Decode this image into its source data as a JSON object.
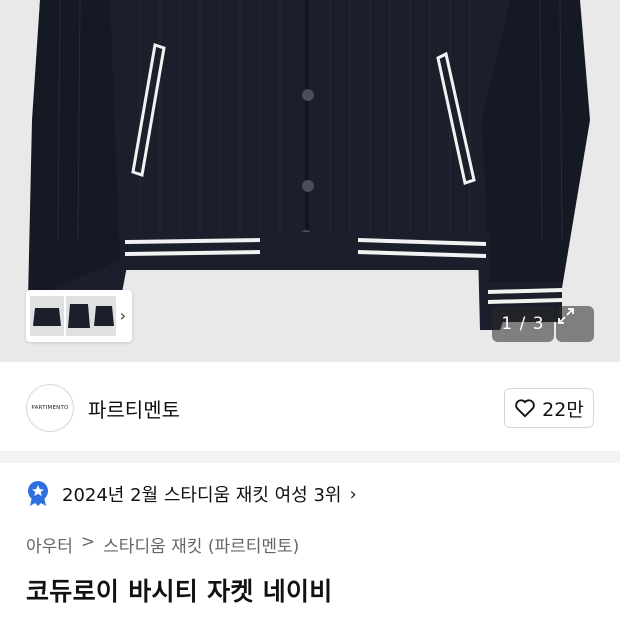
{
  "gallery": {
    "counter": "1 / 3",
    "thumbnail_count": 3
  },
  "seller": {
    "logo_text": "PARTIMENTO",
    "name": "파르티멘토",
    "like_count": "22만"
  },
  "ranking": {
    "text": "2024년 2월 스타디움 재킷 여성 3위"
  },
  "breadcrumb": {
    "items": [
      "아우터",
      "스타디움 재킷 (파르티멘토)"
    ],
    "separator": ">"
  },
  "product": {
    "title": "코듀로이 바시티 자켓 네이비"
  },
  "colors": {
    "jacket": "#1b1f2c",
    "stripe": "#f2f2f2",
    "badge": "#2f6fe0"
  }
}
